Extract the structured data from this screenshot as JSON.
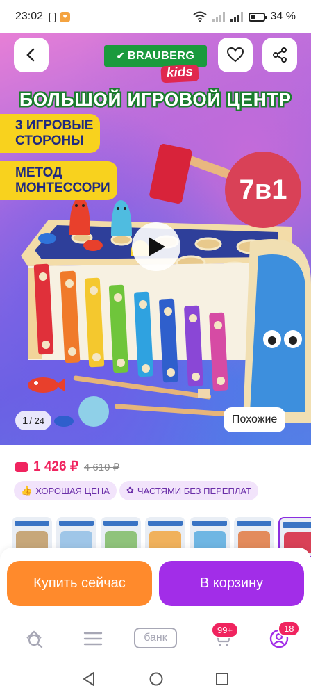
{
  "status_bar": {
    "time": "23:02",
    "battery_percent": "34 %"
  },
  "header": {
    "back_icon": "chevron-left-icon",
    "favorite_icon": "heart-icon",
    "share_icon": "share-icon"
  },
  "banner": {
    "brand": "BRAUBERG",
    "brand_sub": "kids",
    "headline": "БОЛЬШОЙ ИГРОВОЙ ЦЕНТР",
    "tag1_line1": "3 ИГРОВЫЕ",
    "tag1_line2": "СТОРОНЫ",
    "tag2_line1": "МЕТОД",
    "tag2_line2": "МОНТЕССОРИ",
    "badge": "7в1"
  },
  "gallery": {
    "current": "1",
    "total": "/ 24",
    "similar_label": "Похожие",
    "play_icon": "play-icon"
  },
  "price": {
    "current": "1 426 ₽",
    "old": "4 610 ₽",
    "accent_color": "#f0245f"
  },
  "chips": [
    {
      "label": "ХОРОШАЯ ЦЕНА",
      "icon": "thumbs-up-icon"
    },
    {
      "label": "ЧАСТЯМИ БЕЗ ПЕРЕПЛАТ",
      "icon": "flower-icon"
    }
  ],
  "thumbnails": [
    {
      "color": "#c7a77a"
    },
    {
      "color": "#9fc6e8"
    },
    {
      "color": "#8fc37b"
    },
    {
      "color": "#f0b15c"
    },
    {
      "color": "#6fb6e3"
    },
    {
      "color": "#e38b5c"
    },
    {
      "color": "#d94157"
    }
  ],
  "actions": {
    "buy_now": "Купить сейчас",
    "to_cart": "В корзину",
    "buy_color": "#ff8a2c",
    "cart_color": "#a22de8"
  },
  "bottom_nav": {
    "search_icon": "search-icon",
    "catalog_icon": "menu-icon",
    "bank_label": "банк",
    "cart_badge": "99+",
    "profile_badge": "18"
  },
  "system_nav": {
    "back": "triangle-back-icon",
    "home": "circle-home-icon",
    "recents": "square-recents-icon"
  }
}
